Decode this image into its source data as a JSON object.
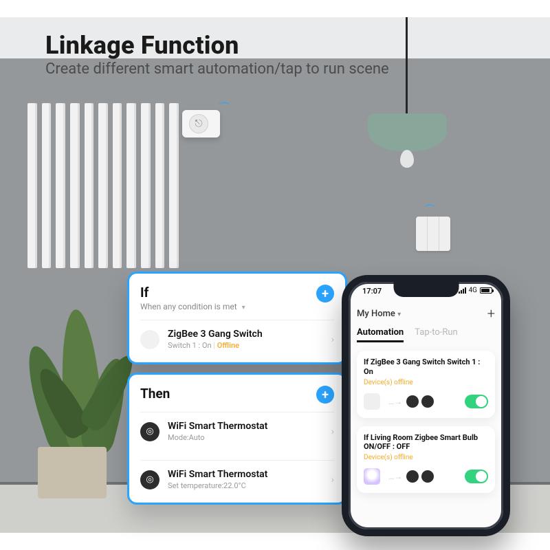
{
  "marketing": {
    "headline": "Linkage Function",
    "subhead": "Create different smart automation/tap to run scene"
  },
  "callout": {
    "if": {
      "title": "If",
      "subtitle": "When any condition is met",
      "rows": [
        {
          "title": "ZigBee 3 Gang Switch",
          "subtitle_prefix": "Switch 1 : On",
          "subtitle_status": "Offline"
        }
      ]
    },
    "then": {
      "title": "Then",
      "rows": [
        {
          "title": "WiFi Smart Thermostat",
          "subtitle": "Mode:Auto"
        },
        {
          "title": "WiFi Smart Thermostat",
          "subtitle": "Set temperature:22.0°C"
        }
      ]
    }
  },
  "phone": {
    "time": "17:07",
    "network": "4G",
    "home_label": "My Home",
    "tabs": {
      "automation": "Automation",
      "tap_to_run": "Tap-to-Run"
    },
    "cards": [
      {
        "title": "If ZigBee 3 Gang Switch Switch 1 : On",
        "status": "Device(s) offline"
      },
      {
        "title": "If  Living Room Zigbee Smart Bulb ON/OFF : OFF",
        "status": "Device(s) offline"
      }
    ]
  }
}
